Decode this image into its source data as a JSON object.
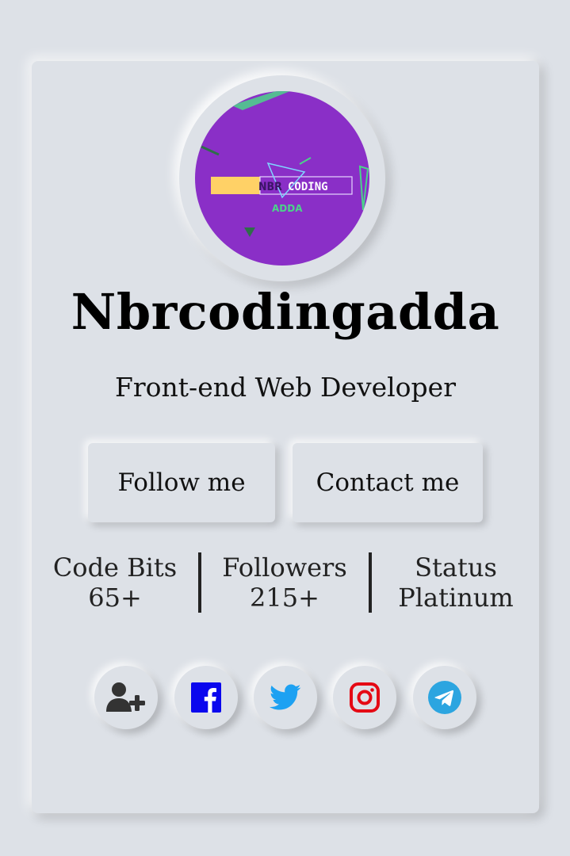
{
  "profile": {
    "name": "Nbrcodingadda",
    "role": "Front-end Web Developer",
    "avatar_text": {
      "left": "NBR",
      "right": "CODING",
      "bottom": "ADDA"
    }
  },
  "buttons": {
    "follow_label": "Follow me",
    "contact_label": "Contact me"
  },
  "stats": [
    {
      "label": "Code Bits",
      "value": "65+"
    },
    {
      "label": "Followers",
      "value": "215+"
    },
    {
      "label": "Status",
      "value": "Platinum"
    }
  ],
  "social": [
    {
      "icon": "user-plus-icon",
      "color": "#333333"
    },
    {
      "icon": "facebook-icon",
      "color": "#0a07ee"
    },
    {
      "icon": "twitter-icon",
      "color": "#1da1f2"
    },
    {
      "icon": "instagram-icon",
      "color": "#e50914"
    },
    {
      "icon": "telegram-icon",
      "color": "#2ca5e0"
    }
  ],
  "colors": {
    "background": "#dde1e7",
    "avatar_bg": "#8a2fc7",
    "avatar_accent_yellow": "#ffd166",
    "avatar_accent_green": "#4bd38a"
  }
}
